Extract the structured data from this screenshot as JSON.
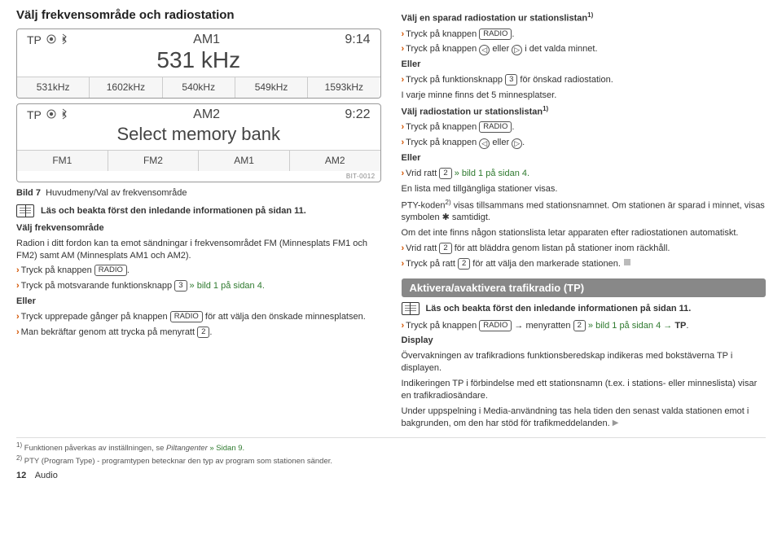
{
  "left": {
    "title": "Välj frekvensområde och radiostation",
    "display1": {
      "tp": "TP",
      "band": "AM1",
      "time": "9:14",
      "freq": "531 kHz",
      "buttons": [
        "531kHz",
        "1602kHz",
        "540kHz",
        "549kHz",
        "1593kHz"
      ]
    },
    "display2": {
      "tp": "TP",
      "band": "AM2",
      "time": "9:22",
      "main": "Select memory bank",
      "buttons": [
        "FM1",
        "FM2",
        "AM1",
        "AM2"
      ],
      "code": "BIT-0012"
    },
    "caption_prefix": "Bild 7",
    "caption": "Huvudmeny/Val av frekvensområde",
    "read_note": "Läs och beakta först den inledande informationen på sidan 11.",
    "h_valj": "Välj frekvensområde",
    "p_radio": "Radion i ditt fordon kan ta emot sändningar i frekvensområdet FM (Minnesplats FM1 och FM2) samt AM (Minnesplats AM1 och AM2).",
    "l1a": "Tryck på knappen ",
    "l1b": ".",
    "l2a": "Tryck på motsvarande funktionsknapp ",
    "l2b": " » bild 1 på sidan 4.",
    "eller": "Eller",
    "l3a": "Tryck upprepade gånger på knappen ",
    "l3b": " för att välja den önskade minnesplatsen.",
    "l4a": "Man bekräftar genom att trycka på menyratt ",
    "l4b": ".",
    "k_radio": "RADIO",
    "k_3": "3",
    "k_2": "2"
  },
  "right": {
    "h1": "Välj en sparad radiostation ur stationslistan",
    "r1a": "Tryck på knappen ",
    "r1b": ".",
    "r2a": "Tryck på knappen ",
    "r2b": " eller ",
    "r2c": " i det valda minnet.",
    "eller": "Eller",
    "r3a": "Tryck på funktionsknapp ",
    "r3b": " för önskad radiostation.",
    "note5": "I varje minne finns det 5 minnesplatser.",
    "h2": "Välj radiostation ur stationslistan",
    "r4a": "Tryck på knappen ",
    "r4b": ".",
    "r5a": "Tryck på knappen ",
    "r5b": " eller ",
    "r5c": ".",
    "r6a": "Vrid ratt ",
    "r6b": " » bild 1 på sidan 4.",
    "lista": "En lista med tillgängliga stationer visas.",
    "pty": "PTY-koden",
    "pty2": " visas tillsammans med stationsnamnet. Om stationen är sparad i minnet, visas symbolen ✱ samtidigt.",
    "auto": "Om det inte finns någon stationslista letar apparaten efter radiostationen automatiskt.",
    "r7a": "Vrid ratt ",
    "r7b": " för att bläddra genom listan på stationer inom räckhåll.",
    "r8a": "Tryck på ratt ",
    "r8b": " för att välja den markerade stationen.",
    "headbar": "Aktivera/avaktivera trafikradio (TP)",
    "read_note": "Läs och beakta först den inledande informationen på sidan 11.",
    "t1a": "Tryck på knappen ",
    "t1b": " → menyratten ",
    "t1c": " » bild 1 på sidan 4 → ",
    "t1d": "TP",
    "t1e": ".",
    "disp_h": "Display",
    "disp_p": "Övervakningen av trafikradions funktionsberedskap indikeras med bokstäverna TP i displayen.",
    "ind_p": "Indikeringen TP i förbindelse med ett stationsnamn (t.ex. i stations- eller minneslista) visar en trafikradiosändare.",
    "media_p": "Under uppspelning i Media-användning tas hela tiden den senast valda stationen emot i bakgrunden, om den har stöd för trafikmeddelanden.",
    "k_radio": "RADIO",
    "k_3": "3",
    "k_2": "2"
  },
  "foot": {
    "n1a": "Funktionen påverkas av inställningen, se ",
    "n1b": "Piltangenter",
    "n1c": " » Sidan 9.",
    "n2": "PTY (Program Type) - programtypen betecknar den typ av program som stationen sänder."
  },
  "page": {
    "num": "12",
    "section": "Audio"
  }
}
